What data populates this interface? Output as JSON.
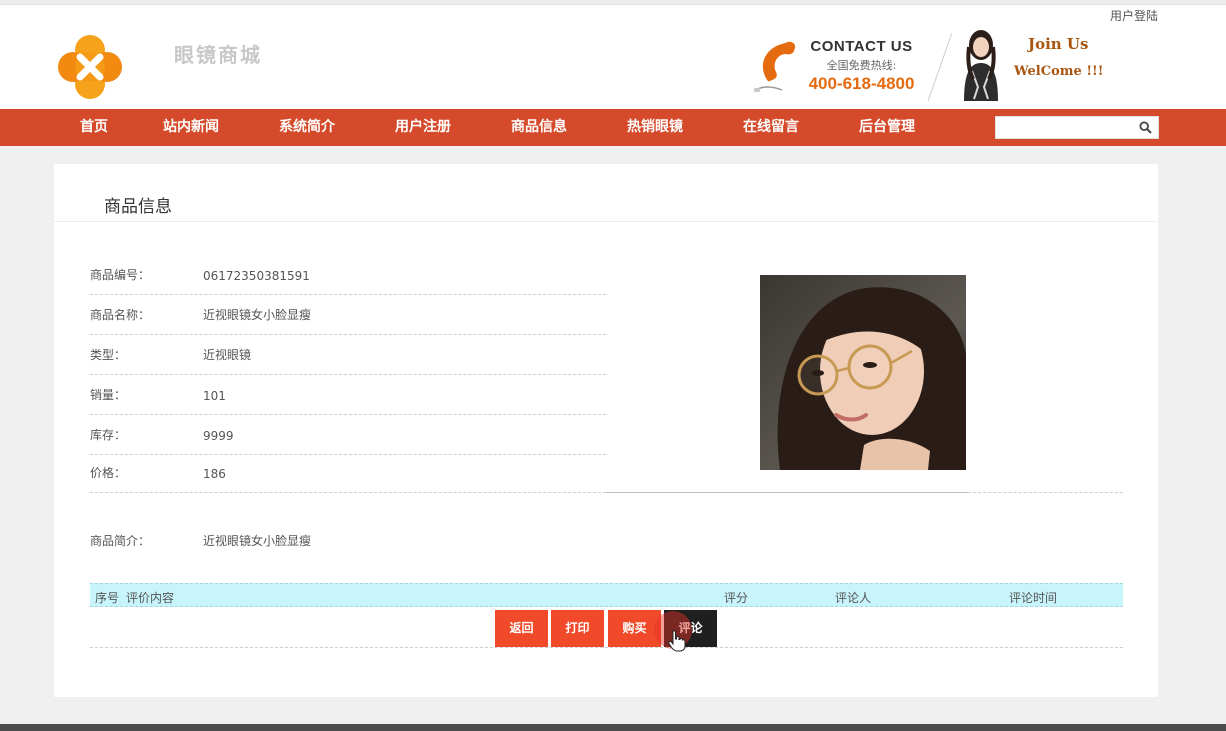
{
  "header": {
    "login_link": "用户登陆",
    "site_name": "眼镜商城",
    "contact_title": "CONTACT US",
    "contact_sub": "全国免费热线:",
    "contact_phone": "400-618-4800",
    "join_us": "Join Us",
    "welcome": "WelCome !!!"
  },
  "nav": {
    "items": [
      "首页",
      "站内新闻",
      "系统简介",
      "用户注册",
      "商品信息",
      "热销眼镜",
      "在线留言",
      "后台管理"
    ],
    "search_value": ""
  },
  "product": {
    "section_title": "商品信息",
    "rows": [
      {
        "label": "商品编号：",
        "value": "06172350381591"
      },
      {
        "label": "商品名称：",
        "value": "近视眼镜女小脸显瘦"
      },
      {
        "label": "类型：",
        "value": "近视眼镜"
      },
      {
        "label": "销量：",
        "value": "101"
      },
      {
        "label": "库存：",
        "value": "9999"
      },
      {
        "label": "价格：",
        "value": "186"
      }
    ],
    "intro_label": "商品简介：",
    "intro_value": "近视眼镜女小脸显瘦"
  },
  "comments": {
    "headers": [
      "序号",
      "评价内容",
      "评分",
      "评论人",
      "评论时间"
    ]
  },
  "actions": {
    "back": "返回",
    "print": "打印",
    "buy": "购买",
    "comment": "评论"
  },
  "colors": {
    "nav_bg": "#d54a2a",
    "button_red": "#f04a2a",
    "button_dark": "#1f1f1f",
    "phone_orange": "#e46b10",
    "table_head_bg": "#c8f4fb"
  }
}
